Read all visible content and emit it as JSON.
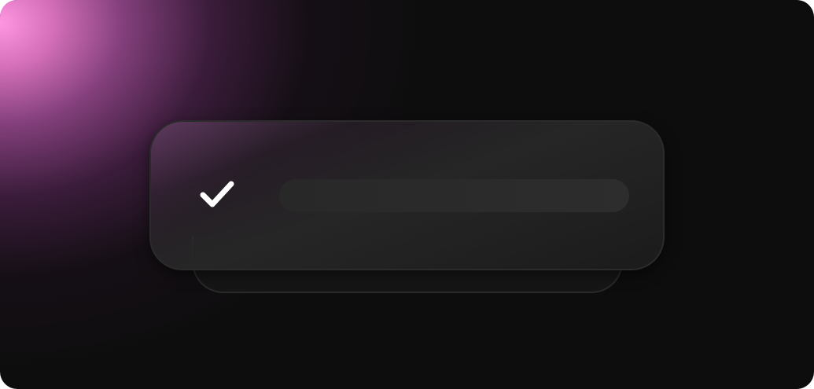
{
  "scene": {
    "background_color": "#0d0d0d",
    "glow_color": "#ff96e1",
    "card_color": "#1b1b1b",
    "card_border_color": "#2b2b2b",
    "placeholder_color": "#2b2b2b",
    "check_icon": {
      "name": "check-icon",
      "color": "#ffffff"
    }
  }
}
